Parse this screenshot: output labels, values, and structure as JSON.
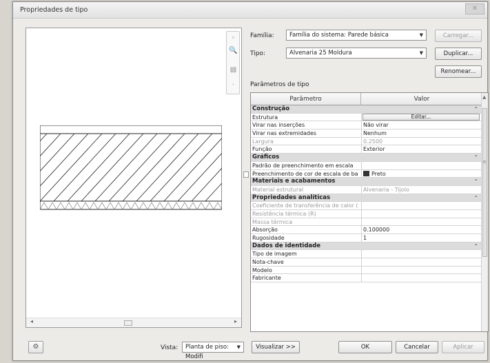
{
  "window": {
    "title": "Propriedades de tipo"
  },
  "preview": {
    "view_label": "Vista:",
    "view_value": "Planta de piso: Modifi",
    "preview_button": "Visualizar >>"
  },
  "header": {
    "family_label": "Família:",
    "family_value": "Família do sistema: Parede básica",
    "type_label": "Tipo:",
    "type_value": "Alvenaria 25 Moldura",
    "load_button": "Carregar...",
    "duplicate_button": "Duplicar...",
    "rename_button": "Renomear..."
  },
  "params": {
    "section_label": "Parâmetros de tipo",
    "col_param": "Parâmetro",
    "col_value": "Valor",
    "rows": [
      {
        "type": "group",
        "k": "Construção"
      },
      {
        "type": "button",
        "k": "Estrutura",
        "v": "Editar..."
      },
      {
        "type": "row",
        "k": "Virar nas inserções",
        "v": "Não virar"
      },
      {
        "type": "row",
        "k": "Virar nas extremidades",
        "v": "Nenhum"
      },
      {
        "type": "disabled",
        "k": "Largura",
        "v": "0.2500"
      },
      {
        "type": "row",
        "k": "Função",
        "v": "Exterior"
      },
      {
        "type": "group",
        "k": "Gráficos"
      },
      {
        "type": "row",
        "k": "Padrão de preenchimento em escala",
        "v": ""
      },
      {
        "type": "swatch",
        "k": "Preenchimento de cor de escala de ba",
        "v": "Preto"
      },
      {
        "type": "group",
        "k": "Materiais e acabamentos"
      },
      {
        "type": "disabled",
        "k": "Material estrutural",
        "v": "Alvenaria - Tijolo"
      },
      {
        "type": "group",
        "k": "Propriedades analíticas"
      },
      {
        "type": "disabled",
        "k": "Coeficiente de transferência de calor (",
        "v": ""
      },
      {
        "type": "disabled",
        "k": "Resistência térmica (R)",
        "v": ""
      },
      {
        "type": "disabled",
        "k": "Massa térmica",
        "v": ""
      },
      {
        "type": "row",
        "k": "Absorção",
        "v": "0.100000"
      },
      {
        "type": "row",
        "k": "Rugosidade",
        "v": "1"
      },
      {
        "type": "group",
        "k": "Dados de identidade"
      },
      {
        "type": "row",
        "k": "Tipo de imagem",
        "v": ""
      },
      {
        "type": "row",
        "k": "Nota-chave",
        "v": ""
      },
      {
        "type": "row",
        "k": "Modelo",
        "v": ""
      },
      {
        "type": "row",
        "k": "Fabricante",
        "v": ""
      }
    ]
  },
  "footer": {
    "ok_button": "OK",
    "cancel_button": "Cancelar",
    "apply_button": "Aplicar"
  }
}
